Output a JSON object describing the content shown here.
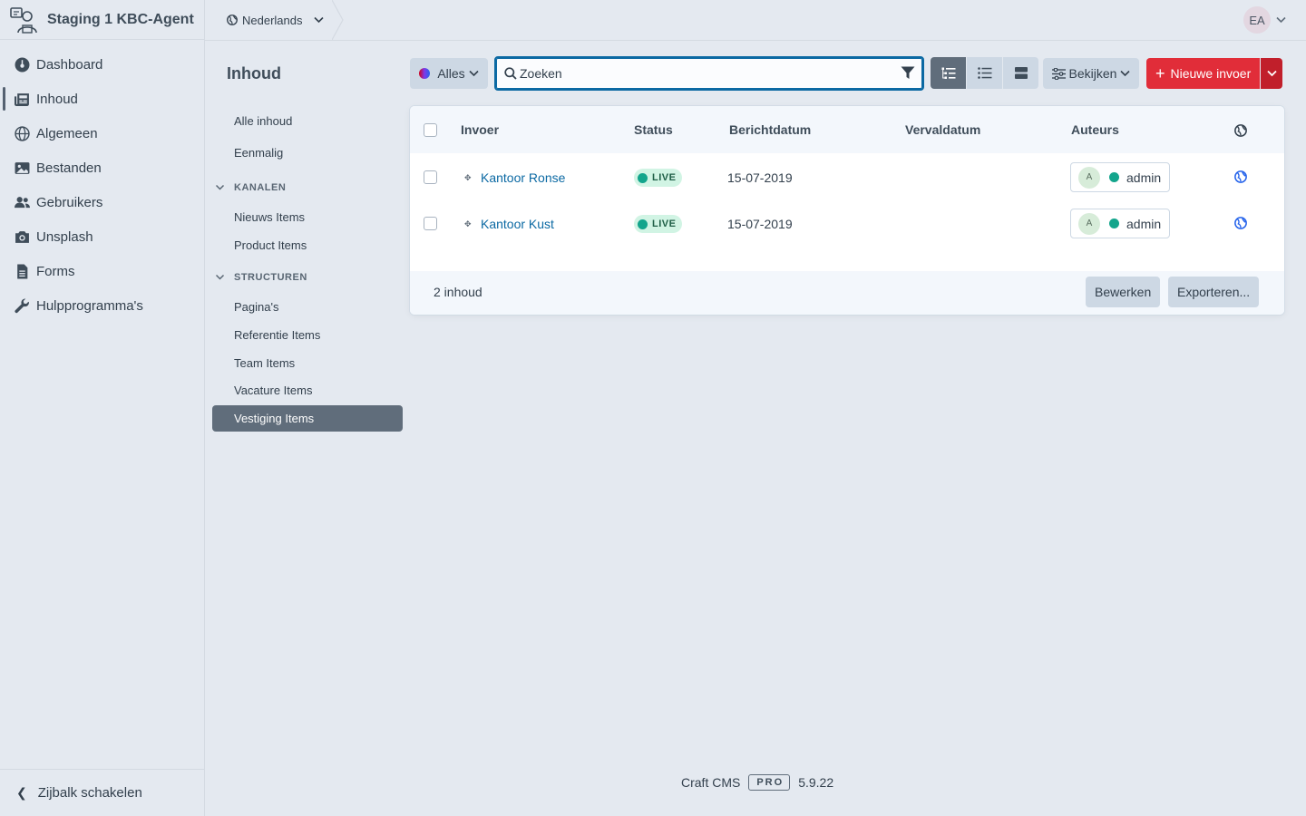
{
  "site": {
    "name": "Staging 1 KBC-Agent"
  },
  "global_nav": {
    "items": [
      {
        "label": "Dashboard",
        "icon": "dashboard-icon"
      },
      {
        "label": "Inhoud",
        "icon": "newspaper-icon",
        "active": true
      },
      {
        "label": "Algemeen",
        "icon": "globe-icon"
      },
      {
        "label": "Bestanden",
        "icon": "image-icon"
      },
      {
        "label": "Gebruikers",
        "icon": "users-icon"
      },
      {
        "label": "Unsplash",
        "icon": "camera-icon"
      },
      {
        "label": "Forms",
        "icon": "file-icon"
      },
      {
        "label": "Hulpprogramma's",
        "icon": "wrench-icon"
      }
    ],
    "toggle_label": "Zijbalk schakelen"
  },
  "header": {
    "site_switcher": "Nederlands",
    "user_initials": "EA"
  },
  "content_nav": {
    "title": "Inhoud",
    "top_items": [
      "Alle inhoud",
      "Eenmalig"
    ],
    "groups": [
      {
        "heading": "KANALEN",
        "items": [
          "Nieuws Items",
          "Product Items"
        ]
      },
      {
        "heading": "STRUCTUREN",
        "items": [
          "Pagina's",
          "Referentie Items",
          "Team Items",
          "Vacature Items",
          "Vestiging Items"
        ]
      }
    ],
    "selected": "Vestiging Items"
  },
  "toolbar": {
    "status_filter": "Alles",
    "search_placeholder": "Zoeken",
    "view_label": "Bekijken",
    "new_entry_label": "Nieuwe invoer"
  },
  "table": {
    "columns": [
      "Invoer",
      "Status",
      "Berichtdatum",
      "Vervaldatum",
      "Auteurs"
    ],
    "rows": [
      {
        "title": "Kantoor Ronse",
        "status": "LIVE",
        "post_date": "15-07-2019",
        "expiry_date": "",
        "author_initial": "A",
        "author": "admin"
      },
      {
        "title": "Kantoor Kust",
        "status": "LIVE",
        "post_date": "15-07-2019",
        "expiry_date": "",
        "author_initial": "A",
        "author": "admin"
      }
    ],
    "count_label": "2 inhoud",
    "edit_label": "Bewerken",
    "export_label": "Exporteren..."
  },
  "footer": {
    "product": "Craft CMS",
    "edition": "PRO",
    "version": "5.9.22"
  },
  "colors": {
    "accent_red": "#e12d39",
    "link_blue": "#0b69a3",
    "live_green": "#13a58c",
    "selected_nav": "#606d7b"
  }
}
